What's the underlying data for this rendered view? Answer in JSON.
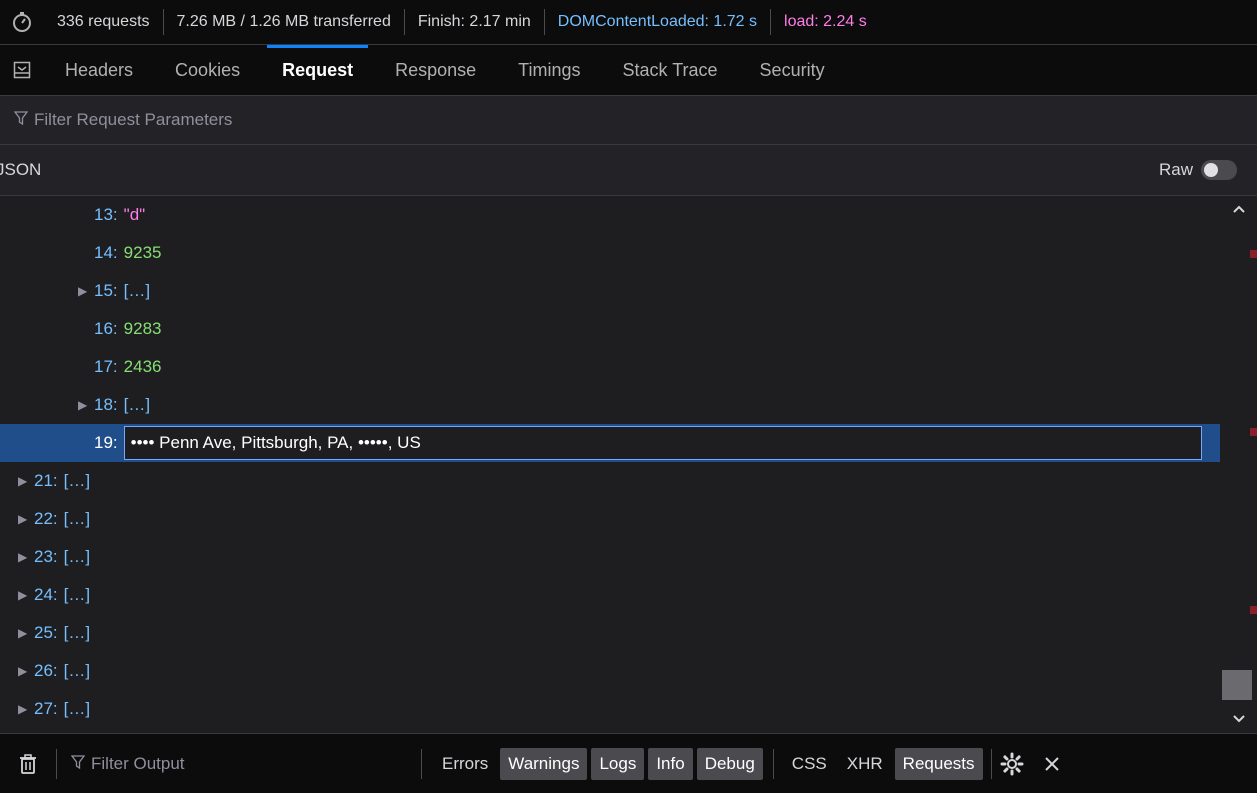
{
  "status": {
    "requests": "336 requests",
    "transferred": "7.26 MB / 1.26 MB transferred",
    "finish": "Finish: 2.17 min",
    "dom_content_loaded": "DOMContentLoaded: 1.72 s",
    "load": "load: 2.24 s"
  },
  "tabs": [
    "Headers",
    "Cookies",
    "Request",
    "Response",
    "Timings",
    "Stack Trace",
    "Security"
  ],
  "active_tab": "Request",
  "param_filter": {
    "placeholder": "Filter Request Parameters"
  },
  "json_header": {
    "label": "JSON",
    "raw_label": "Raw"
  },
  "tree": {
    "rows": [
      {
        "key": "13",
        "value": "\"d\"",
        "type": "string",
        "expandable": false
      },
      {
        "key": "14",
        "value": "9235",
        "type": "number",
        "expandable": false
      },
      {
        "key": "15",
        "value": "[…]",
        "type": "array",
        "expandable": true
      },
      {
        "key": "16",
        "value": "9283",
        "type": "number",
        "expandable": false
      },
      {
        "key": "17",
        "value": "2436",
        "type": "number",
        "expandable": false
      },
      {
        "key": "18",
        "value": "[…]",
        "type": "array",
        "expandable": true
      },
      {
        "key": "19",
        "value": "•••• Penn Ave, Pittsburgh, PA, •••••, US",
        "type": "selected",
        "expandable": false
      }
    ],
    "outer_rows": [
      {
        "key": "21",
        "value": "[…]"
      },
      {
        "key": "22",
        "value": "[…]"
      },
      {
        "key": "23",
        "value": "[…]"
      },
      {
        "key": "24",
        "value": "[…]"
      },
      {
        "key": "25",
        "value": "[…]"
      },
      {
        "key": "26",
        "value": "[…]"
      },
      {
        "key": "27",
        "value": "[…]"
      }
    ]
  },
  "console": {
    "filter_placeholder": "Filter Output",
    "filters": [
      {
        "label": "Errors",
        "on": false
      },
      {
        "label": "Warnings",
        "on": true
      },
      {
        "label": "Logs",
        "on": true
      },
      {
        "label": "Info",
        "on": true
      },
      {
        "label": "Debug",
        "on": true
      }
    ],
    "extra_filters": [
      {
        "label": "CSS",
        "on": false
      },
      {
        "label": "XHR",
        "on": false
      },
      {
        "label": "Requests",
        "on": true
      }
    ]
  },
  "icons": [
    "stopwatch-icon",
    "panel-toggle-icon",
    "filter-icon",
    "trash-icon",
    "gear-icon",
    "close-icon",
    "chevron-up-icon",
    "chevron-down-icon",
    "twisty-icon"
  ]
}
